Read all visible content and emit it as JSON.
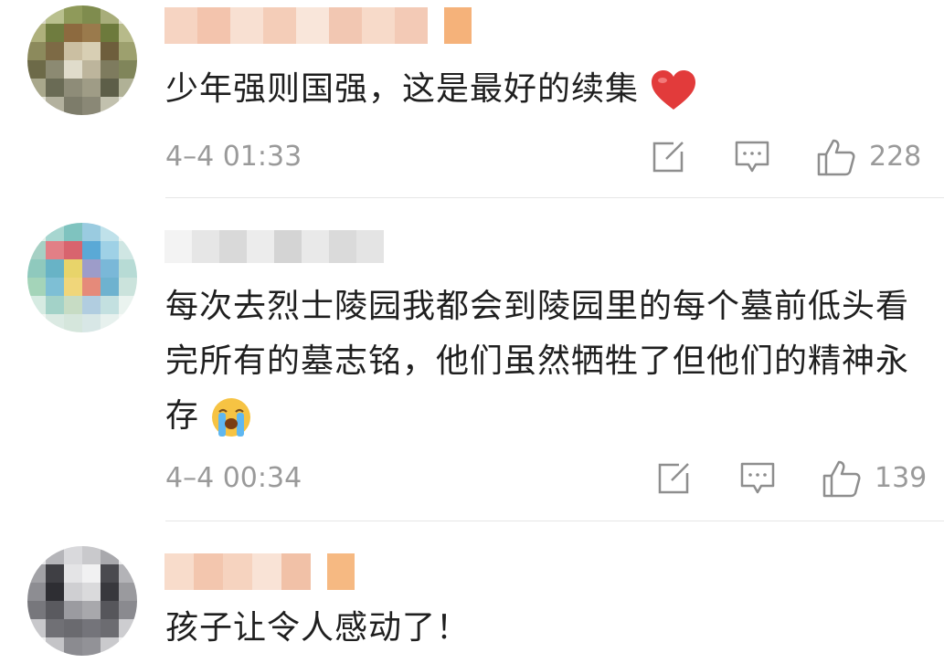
{
  "comments": [
    {
      "text": "少年强则国强，这是最好的续集",
      "emoji": "red-heart",
      "time": "4–4 01:33",
      "likes": "228"
    },
    {
      "text": "每次去烈士陵园我都会到陵园里的每个墓前低头看完所有的墓志铭，他们虽然牺牲了但他们的精神永存",
      "emoji": "loudly-crying-face",
      "time": "4–4 00:34",
      "likes": "139"
    },
    {
      "text": "孩子让令人感动了！"
    }
  ],
  "colors": {
    "meta_gray": "#9a9a9a",
    "heart_red": "#e23b3b",
    "divider": "#e6e6e6"
  }
}
